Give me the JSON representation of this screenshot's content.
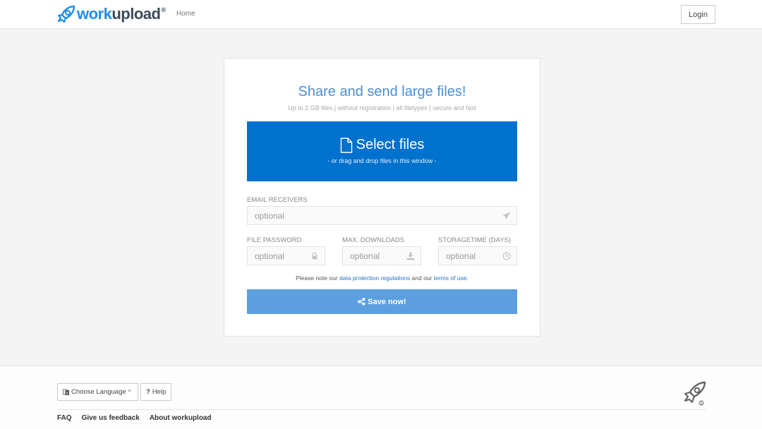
{
  "header": {
    "logo_work": "work",
    "logo_upload": "upload",
    "logo_reg": "®",
    "nav_home": "Home",
    "login_label": "Login"
  },
  "upload_card": {
    "title": "Share and send large files!",
    "subtitle": "Up to 2 GB files | without registration | all filetypes | secure and fast",
    "select_files_label": "Select files",
    "select_files_hint": "- or drag and drop files in this window -",
    "email_receivers": {
      "label": "EMAIL RECEIVERS",
      "placeholder": "optional",
      "value": "",
      "icon": "paper-plane-icon"
    },
    "file_password": {
      "label": "FILE PASSWORD",
      "placeholder": "optional",
      "value": "",
      "icon": "lock-icon"
    },
    "max_downloads": {
      "label": "MAX. DOWNLOADS",
      "placeholder": "optional",
      "value": "",
      "icon": "download-icon"
    },
    "storagetime": {
      "label": "STORAGETIME (DAYS)",
      "placeholder": "optional",
      "value": "",
      "icon": "clock-icon"
    },
    "notice_prefix": "Please note our ",
    "notice_link1": "data protection regulations",
    "notice_middle": " and our ",
    "notice_link2": "terms of use",
    "notice_suffix": ".",
    "save_label": "Save now!"
  },
  "footer": {
    "language_label": "Choose Language",
    "help_label": "Help",
    "links": [
      "FAQ",
      "Give us feedback",
      "About workupload"
    ]
  },
  "colors": {
    "brand_blue": "#1f8ee8",
    "select_bg": "#0071cc",
    "save_bg": "#5b9fdf",
    "title_blue": "#4a8fd6"
  }
}
